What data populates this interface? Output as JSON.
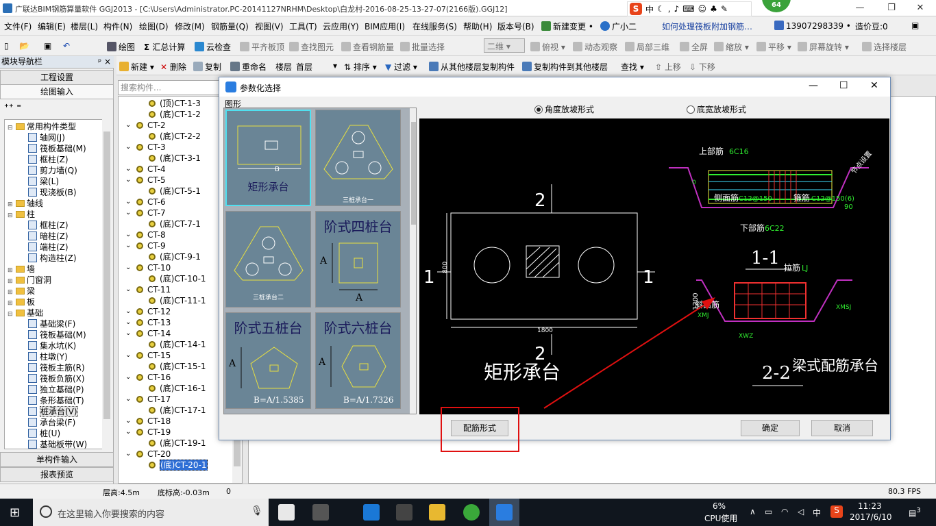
{
  "app": {
    "title": "广联达BIM钢筋算量软件 GGJ2013 - [C:\\Users\\Administrator.PC-20141127NRHM\\Desktop\\白龙村-2016-08-25-13-27-07(2166版).GGJ12]",
    "badge": "64",
    "ime": {
      "s": "S",
      "zh": "中"
    },
    "window_controls": {
      "min": "—",
      "max": "❐",
      "close": "✕"
    }
  },
  "menu": [
    "文件(F)",
    "编辑(E)",
    "楼层(L)",
    "构件(N)",
    "绘图(D)",
    "修改(M)",
    "钢筋量(Q)",
    "视图(V)",
    "工具(T)",
    "云应用(Y)",
    "BIM应用(I)",
    "在线服务(S)",
    "帮助(H)",
    "版本号(B)",
    "新建变更 •",
    "广小二",
    "如何处理筏板附加钢筋…",
    "13907298339 •",
    "造价豆:0"
  ],
  "toolbar1": {
    "draw": "绘图",
    "sum": "汇总计算",
    "cloud_check": "云检查",
    "flush_slab": "平齐板顶",
    "find_elem": "查找图元",
    "view_rebar": "查看钢筋量",
    "batch_select": "批量选择",
    "view_mode": "二维",
    "view_top": "俯视",
    "dynamic": "动态观察",
    "local3d": "局部三维",
    "fullscreen": "全屏",
    "zoom": "缩放",
    "pan": "平移",
    "rotate": "屏幕旋转",
    "select_floor": "选择楼层"
  },
  "toolbar2": {
    "new": "新建",
    "delete": "删除",
    "copy": "复制",
    "rename": "重命名",
    "floor_label": "楼层",
    "floor_value": "首层",
    "sort": "排序",
    "filter": "过滤",
    "copy_from": "从其他楼层复制构件",
    "copy_to": "复制构件到其他楼层",
    "find": "查找",
    "up": "上移",
    "down": "下移"
  },
  "leftnav": {
    "title": "模块导航栏",
    "pin": "ᵖ ×",
    "project_settings": "工程设置",
    "draw_input": "绘图输入",
    "single_input": "单构件输入",
    "report": "报表预览",
    "tree": [
      {
        "label": "常用构件类型",
        "level": 0,
        "type": "folder",
        "toggle": "⊟"
      },
      {
        "label": "轴网(J)",
        "level": 1,
        "type": "item"
      },
      {
        "label": "筏板基础(M)",
        "level": 1,
        "type": "item"
      },
      {
        "label": "框柱(Z)",
        "level": 1,
        "type": "item"
      },
      {
        "label": "剪力墙(Q)",
        "level": 1,
        "type": "item"
      },
      {
        "label": "梁(L)",
        "level": 1,
        "type": "item"
      },
      {
        "label": "现浇板(B)",
        "level": 1,
        "type": "item"
      },
      {
        "label": "轴线",
        "level": 0,
        "type": "folder",
        "toggle": "⊞"
      },
      {
        "label": "柱",
        "level": 0,
        "type": "folder",
        "toggle": "⊟"
      },
      {
        "label": "框柱(Z)",
        "level": 1,
        "type": "item"
      },
      {
        "label": "暗柱(Z)",
        "level": 1,
        "type": "item"
      },
      {
        "label": "端柱(Z)",
        "level": 1,
        "type": "item"
      },
      {
        "label": "构造柱(Z)",
        "level": 1,
        "type": "item"
      },
      {
        "label": "墙",
        "level": 0,
        "type": "folder",
        "toggle": "⊞"
      },
      {
        "label": "门窗洞",
        "level": 0,
        "type": "folder",
        "toggle": "⊞"
      },
      {
        "label": "梁",
        "level": 0,
        "type": "folder",
        "toggle": "⊞"
      },
      {
        "label": "板",
        "level": 0,
        "type": "folder",
        "toggle": "⊞"
      },
      {
        "label": "基础",
        "level": 0,
        "type": "folder",
        "toggle": "⊟"
      },
      {
        "label": "基础梁(F)",
        "level": 1,
        "type": "item"
      },
      {
        "label": "筏板基础(M)",
        "level": 1,
        "type": "item"
      },
      {
        "label": "集水坑(K)",
        "level": 1,
        "type": "item"
      },
      {
        "label": "柱墩(Y)",
        "level": 1,
        "type": "item"
      },
      {
        "label": "筏板主筋(R)",
        "level": 1,
        "type": "item"
      },
      {
        "label": "筏板负筋(X)",
        "level": 1,
        "type": "item"
      },
      {
        "label": "独立基础(P)",
        "level": 1,
        "type": "item"
      },
      {
        "label": "条形基础(T)",
        "level": 1,
        "type": "item"
      },
      {
        "label": "桩承台(V)",
        "level": 1,
        "type": "item",
        "selected": true
      },
      {
        "label": "承台梁(F)",
        "level": 1,
        "type": "item"
      },
      {
        "label": "桩(U)",
        "level": 1,
        "type": "item"
      },
      {
        "label": "基础板带(W)",
        "level": 1,
        "type": "item"
      }
    ]
  },
  "search": {
    "placeholder": "搜索构件..."
  },
  "comptree": [
    {
      "label": "(顶)CT-1-3",
      "level": 1
    },
    {
      "label": "(底)CT-1-2",
      "level": 1
    },
    {
      "label": "CT-2",
      "level": 0
    },
    {
      "label": "(底)CT-2-2",
      "level": 1
    },
    {
      "label": "CT-3",
      "level": 0
    },
    {
      "label": "(底)CT-3-1",
      "level": 1
    },
    {
      "label": "CT-4",
      "level": 0
    },
    {
      "label": "CT-5",
      "level": 0
    },
    {
      "label": "(底)CT-5-1",
      "level": 1
    },
    {
      "label": "CT-6",
      "level": 0
    },
    {
      "label": "CT-7",
      "level": 0
    },
    {
      "label": "(底)CT-7-1",
      "level": 1
    },
    {
      "label": "CT-8",
      "level": 0
    },
    {
      "label": "CT-9",
      "level": 0
    },
    {
      "label": "(底)CT-9-1",
      "level": 1
    },
    {
      "label": "CT-10",
      "level": 0
    },
    {
      "label": "(底)CT-10-1",
      "level": 1
    },
    {
      "label": "CT-11",
      "level": 0
    },
    {
      "label": "(底)CT-11-1",
      "level": 1
    },
    {
      "label": "CT-12",
      "level": 0
    },
    {
      "label": "CT-13",
      "level": 0
    },
    {
      "label": "CT-14",
      "level": 0
    },
    {
      "label": "(底)CT-14-1",
      "level": 1
    },
    {
      "label": "CT-15",
      "level": 0
    },
    {
      "label": "(底)CT-15-1",
      "level": 1
    },
    {
      "label": "CT-16",
      "level": 0
    },
    {
      "label": "(底)CT-16-1",
      "level": 1
    },
    {
      "label": "CT-17",
      "level": 0
    },
    {
      "label": "(底)CT-17-1",
      "level": 1
    },
    {
      "label": "CT-18",
      "level": 0
    },
    {
      "label": "CT-19",
      "level": 0
    },
    {
      "label": "(底)CT-19-1",
      "level": 1
    },
    {
      "label": "CT-20",
      "level": 0
    },
    {
      "label": "(底)CT-20-1",
      "level": 1,
      "selected": true
    }
  ],
  "dialog": {
    "title": "参数化选择",
    "shapes_label": "图形",
    "radio_angle": "角度放坡形式",
    "radio_bottom": "底宽放坡形式",
    "btn_rebar": "配筋形式",
    "btn_ok": "确定",
    "btn_cancel": "取消",
    "cards": {
      "rect": "矩形承台",
      "rect_b": "B",
      "three_pile_1": "三桩承台一",
      "three_pile_2": "三桩承台二",
      "four_pile": "阶式四桩台",
      "five_pile": "阶式五桩台",
      "five_formula": "B=A/1.5385",
      "six_pile": "阶式六桩台",
      "six_formula": "B=A/1.7326",
      "dim_a": "A"
    },
    "preview": {
      "title_left": "矩形承台",
      "title_right": "梁式配筋承台",
      "sec1": "1",
      "sec2": "2",
      "dim_800": "800",
      "dim_1800": "1800",
      "s11": "1-1",
      "s22": "2-2",
      "top_rebar": "上部筋",
      "top_val": "6C16",
      "side_rebar": "侧面筋",
      "side_val": "C12@150",
      "stirrup": "箍筋",
      "stirrup_val": "C12@150(6)",
      "bottom_rebar": "下部筋",
      "bottom_val": "6C22",
      "tie": "拉筋",
      "tie_val": "LJ",
      "slope": "斜面筋",
      "xmj": "XMJ",
      "xmsj": "XMSJ",
      "xwz": "XWZ",
      "d1200": "1200",
      "d1000": "1000",
      "d100": "100",
      "d90": "90",
      "d0": "0",
      "note": "节点设置"
    }
  },
  "status": {
    "floor_height": "层高:4.5m",
    "bottom_elev": "底标高:-0.03m",
    "zero": "0",
    "fps": "80.3 FPS"
  },
  "taskbar": {
    "search_placeholder": "在这里输入你要搜索的内容",
    "cpu_pct": "6%",
    "cpu_label": "CPU使用",
    "time": "11:23",
    "date": "2017/6/10",
    "ime": "中",
    "notif": "3"
  }
}
